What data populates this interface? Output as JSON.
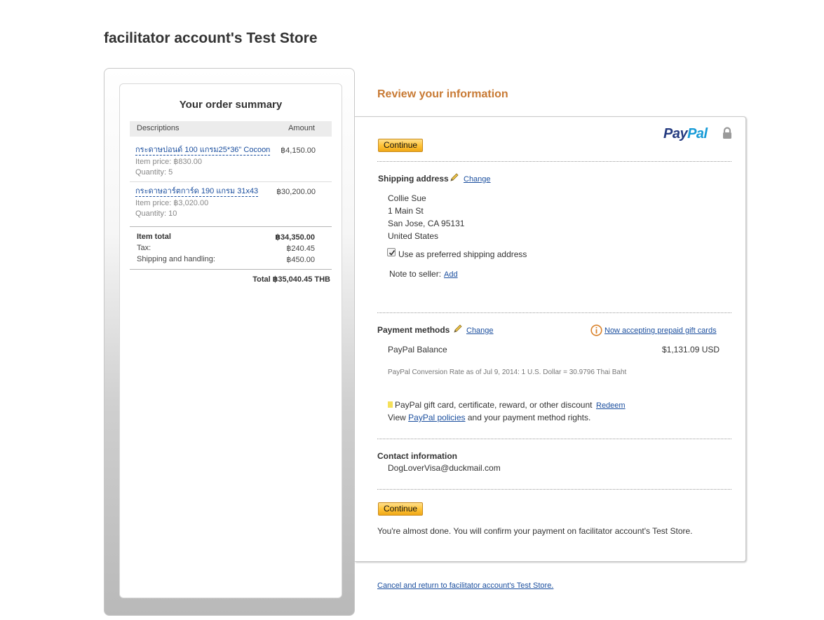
{
  "store": {
    "title": "facilitator account's Test Store"
  },
  "order_summary": {
    "heading": "Your order summary",
    "columns": {
      "description": "Descriptions",
      "amount": "Amount"
    },
    "items": [
      {
        "name": "กระดาษปอนด์ 100 แกรม25*36\" Cocoon",
        "amount": "฿4,150.00",
        "item_price": "Item price: ฿830.00",
        "quantity": "Quantity: 5"
      },
      {
        "name": "กระดาษอาร์ตการ์ด 190 แกรม 31x43",
        "amount": "฿30,200.00",
        "item_price": "Item price: ฿3,020.00",
        "quantity": "Quantity: 10"
      }
    ],
    "item_total_label": "Item total",
    "item_total": "฿34,350.00",
    "tax_label": "Tax:",
    "tax": "฿240.45",
    "shipping_label": "Shipping and handling:",
    "shipping": "฿450.00",
    "grand_total": "Total ฿35,040.45 THB"
  },
  "review": {
    "heading": "Review your information",
    "continue_label": "Continue",
    "shipping": {
      "title": "Shipping address",
      "change_label": "Change",
      "address_lines": [
        "Collie Sue",
        "1 Main St",
        "San Jose, CA 95131",
        "United States"
      ],
      "preferred_label": "Use as preferred shipping address",
      "preferred_checked": true,
      "note_label": "Note to seller:",
      "note_add_label": "Add"
    },
    "payment": {
      "title": "Payment methods",
      "change_label": "Change",
      "gift_card_notice": "Now accepting prepaid gift cards",
      "method": "PayPal Balance",
      "amount": "$1,131.09 USD",
      "conversion": "PayPal Conversion Rate as of Jul 9, 2014: 1 U.S. Dollar = 30.9796 Thai Baht",
      "gift_text": "PayPal gift card, certificate, reward, or other discount",
      "redeem_label": "Redeem",
      "view_prefix": "View",
      "policies_label": "PayPal policies",
      "view_suffix": "and your payment method rights."
    },
    "contact": {
      "title": "Contact information",
      "email": "DogLoverVisa@duckmail.com"
    },
    "almost_done": "You're almost done. You will confirm your payment on facilitator account's Test Store.",
    "cancel_link": "Cancel and return to facilitator account's Test Store."
  },
  "brand": {
    "paypal_pay": "Pay",
    "paypal_pal": "Pal",
    "colors": {
      "accent": "#c87a34",
      "button": "#ffc439",
      "link": "#1a4e9e"
    }
  },
  "icons": [
    "lock-icon",
    "pencil-icon",
    "info-icon",
    "checkmark-icon"
  ]
}
